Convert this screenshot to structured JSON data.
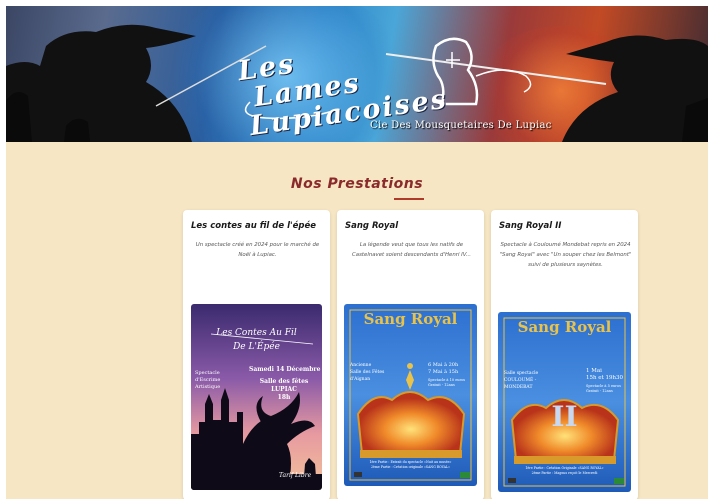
{
  "banner": {
    "logo_line1": "Les",
    "logo_line2": "Lames",
    "logo_line3": "Lupiacoises",
    "subtitle": "Cie Des Mousquetaires De Lupiac"
  },
  "section": {
    "title": "Nos Prestations"
  },
  "cards": [
    {
      "title": "Les contes au fil de l'épée",
      "description": "Un spectacle créé en 2024 pour le marché de Noël à Lupiac.",
      "poster": {
        "title_line1": "Les Contes Au Fil",
        "title_line2": "De L'Épée",
        "left_text": [
          "Spectacle",
          "d'Escrime",
          "Artistique"
        ],
        "date": "Samedi 14 Décembre",
        "venue_line1": "Salle des fêtes",
        "venue_line2": "LUPIAC",
        "time": "18h",
        "price": "Tarif Libre"
      }
    },
    {
      "title": "Sang Royal",
      "description": "La légende veut que tous les natifs de Castelnavet soient descendants d'Henri IV...",
      "poster": {
        "title": "Sang Royal",
        "left_text": [
          "Ancienne",
          "Salle des Fêtes",
          "d'Aignan"
        ],
        "dates": [
          "6 Mai à 20h",
          "7 Mai à 15h"
        ],
        "notes": [
          "Spectacle à 10 euros",
          "Gratuit - 12ans"
        ],
        "footer": [
          "1ère Partie : Extrait du spectacle «Nuit au musée»",
          "2ème Partie : Création originale «SANG ROYAL»"
        ]
      }
    },
    {
      "title": "Sang Royal II",
      "description": "Spectacle à Couloumé Mondebat repris en 2024 \"Sang Royal\" avec \"Un souper chez les Belmont\" suivi de plusieurs saynètes.",
      "poster": {
        "title": "Sang Royal",
        "numeral": "II",
        "left_text": [
          "Salle spectacle",
          "COULOUMÉ -",
          "MONDEBAT"
        ],
        "dates": [
          "1 Mai",
          "15h et 19h30"
        ],
        "notes": [
          "Spectacle à 5 euros",
          "Gratuit - 12ans"
        ],
        "footer": [
          "1ère Partie : Création Originale «SANG ROYAL»",
          "2ème Partie : Magnus reçoit le Mercredi"
        ]
      }
    }
  ],
  "colors": {
    "page_bg": "#f6e6c3",
    "title_red": "#8a2a2a",
    "rule_red": "#b03a2a",
    "card_bg": "#ffffff"
  }
}
